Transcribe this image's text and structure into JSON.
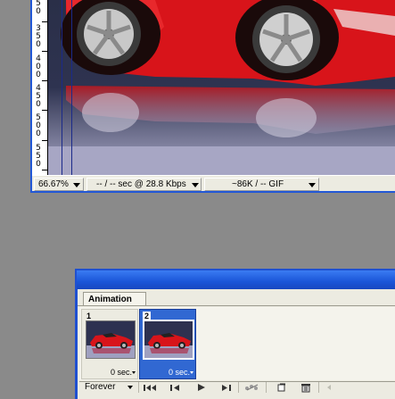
{
  "document": {
    "ruler_labels": [
      "5",
      "0",
      "3",
      "5",
      "0",
      "4",
      "0",
      "0",
      "4",
      "5",
      "0",
      "5",
      "0",
      "0",
      "5",
      "5",
      "0"
    ],
    "status": {
      "zoom": "66.67%",
      "download_time": "-- / -- sec @ 28.8 Kbps",
      "optimized_info": "~86K / -- GIF"
    }
  },
  "animation_panel": {
    "tab_label": "Animation",
    "frames": [
      {
        "number": "1",
        "delay": "0 sec.",
        "selected": false
      },
      {
        "number": "2",
        "delay": "0 sec.",
        "selected": true
      }
    ],
    "loop_option": "Forever",
    "controls": [
      {
        "icon": "select-first-frame-icon"
      },
      {
        "icon": "select-previous-frame-icon"
      },
      {
        "icon": "play-icon"
      },
      {
        "icon": "select-next-frame-icon"
      },
      {
        "icon": "tween-icon"
      },
      {
        "icon": "duplicate-frame-icon"
      },
      {
        "icon": "delete-frame-icon"
      }
    ]
  },
  "colors": {
    "window_frame": "#2358d6",
    "selected_frame": "#3168d2",
    "car_red": "#d8141a"
  }
}
